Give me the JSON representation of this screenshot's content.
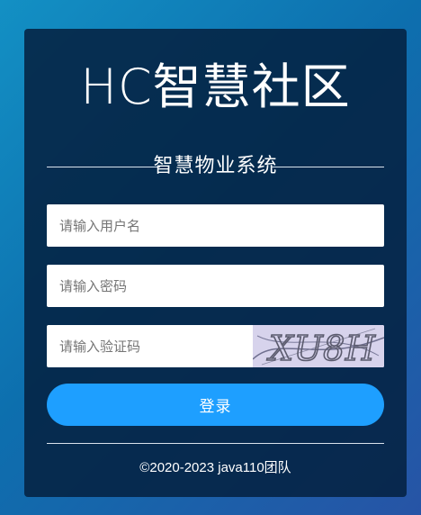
{
  "login": {
    "title": "HC智慧社区",
    "subtitle": "智慧物业系统",
    "username_placeholder": "请输入用户名",
    "password_placeholder": "请输入密码",
    "captcha_placeholder": "请输入验证码",
    "captcha_text": "XU8H",
    "login_label": "登录",
    "copyright": "©2020-2023 java110团队"
  },
  "colors": {
    "background_start": "#1390c4",
    "background_end": "#2754a6",
    "panel": "#052242",
    "button": "#1e9fff",
    "captcha_bg": "#d7d3ec"
  }
}
